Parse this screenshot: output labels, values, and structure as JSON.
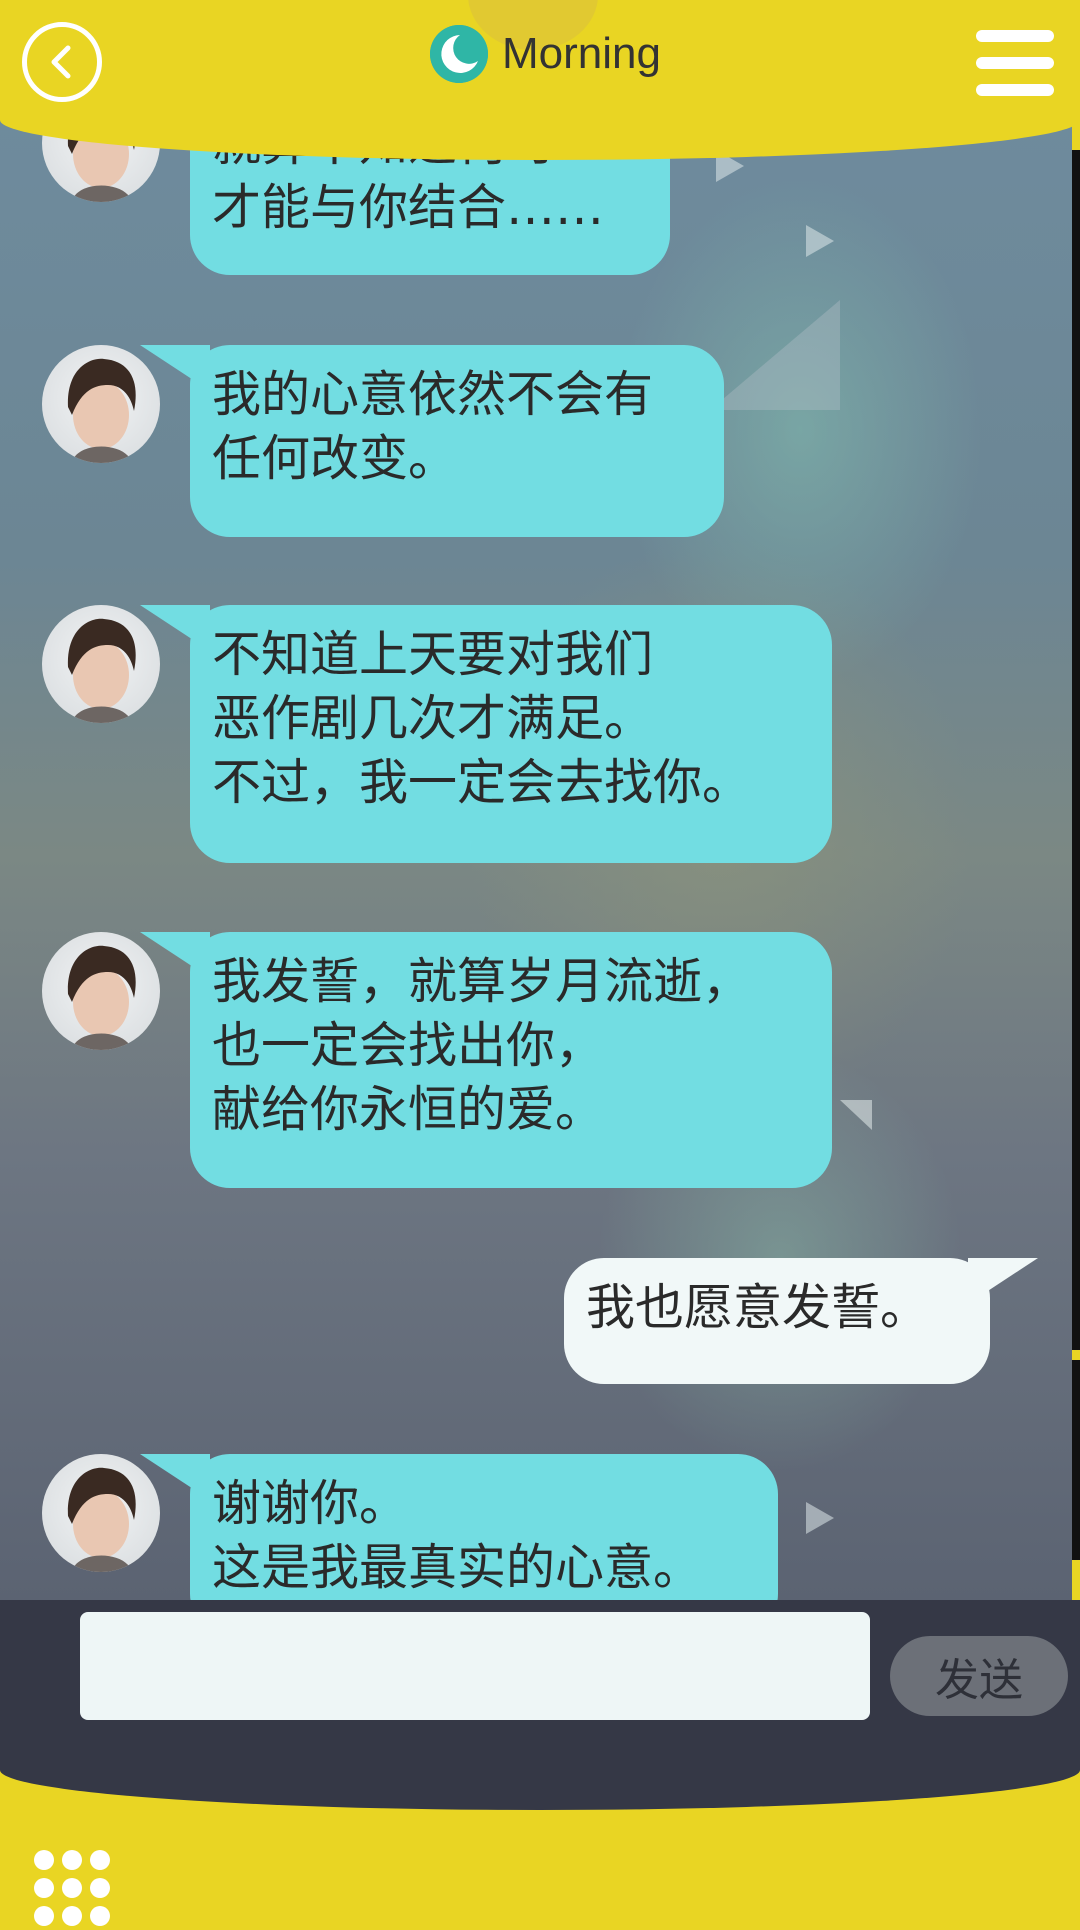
{
  "header": {
    "title": "Morning",
    "back_icon": "chevron-left-icon",
    "time_icon": "moon-icon",
    "menu_icon": "hamburger-menu-icon"
  },
  "messages": [
    {
      "from": "them",
      "lines": [
        "就算不知道何时",
        "才能与你结合……"
      ]
    },
    {
      "from": "them",
      "lines": [
        "我的心意依然不会有",
        "任何改变。"
      ]
    },
    {
      "from": "them",
      "lines": [
        "不知道上天要对我们",
        "恶作剧几次才满足。",
        "不过，我一定会去找你。"
      ]
    },
    {
      "from": "them",
      "lines": [
        "我发誓，就算岁月流逝，",
        "也一定会找出你，",
        "献给你永恒的爱。"
      ]
    },
    {
      "from": "me",
      "lines": [
        "我也愿意发誓。"
      ]
    },
    {
      "from": "them",
      "lines": [
        "谢谢你。",
        "这是我最真实的心意。"
      ]
    }
  ],
  "input": {
    "value": "",
    "placeholder": "",
    "send_label": "发送"
  },
  "footer": {
    "apps_icon": "grid-dots-icon"
  },
  "colors": {
    "frame_yellow": "#e9d523",
    "bubble_incoming": "#72dde2",
    "bubble_outgoing": "#f1f8f8",
    "input_bar": "#353846"
  }
}
